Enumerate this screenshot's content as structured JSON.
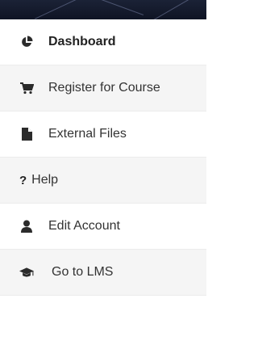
{
  "menu": {
    "items": [
      {
        "label": "Dashboard",
        "icon": "pie-chart-icon"
      },
      {
        "label": "Register for Course",
        "icon": "cart-icon"
      },
      {
        "label": "External Files",
        "icon": "file-icon"
      },
      {
        "label": "Help",
        "icon": "question-icon"
      },
      {
        "label": "Edit Account",
        "icon": "user-icon"
      },
      {
        "label": "Go to LMS",
        "icon": "graduation-cap-icon"
      }
    ]
  },
  "colors": {
    "banner": "#141a2c",
    "icon": "#2b2b2b",
    "text": "#333333",
    "alt_row": "#f5f5f5"
  }
}
